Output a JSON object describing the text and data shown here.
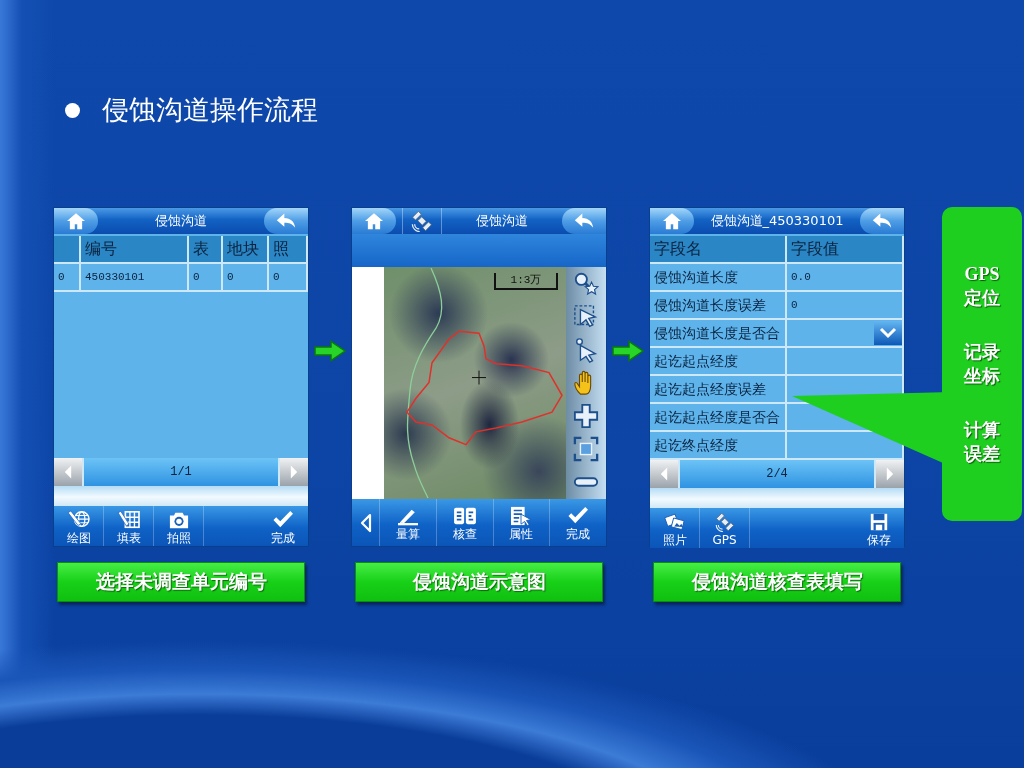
{
  "slide": {
    "title": "侵蚀沟道操作流程"
  },
  "screens": [
    {
      "kind": "table",
      "title": "侵蚀沟道",
      "columns": [
        "编号",
        "表",
        "地块",
        "照"
      ],
      "rows": [
        {
          "index": "0",
          "cells": [
            "450330101",
            "0",
            "0",
            "0"
          ]
        }
      ],
      "page": "1/1",
      "toolbar": [
        {
          "kind": "draw",
          "label": "绘图"
        },
        {
          "kind": "form",
          "label": "填表"
        },
        {
          "kind": "photo",
          "label": "拍照"
        },
        {
          "kind": "done",
          "label": "完成"
        }
      ],
      "caption": "选择未调查单元编号"
    },
    {
      "kind": "map",
      "title": "侵蚀沟道",
      "scale": "1:3万",
      "toolbar": [
        {
          "kind": "measure",
          "label": "量算"
        },
        {
          "kind": "check",
          "label": "核查"
        },
        {
          "kind": "attribute",
          "label": "属性"
        },
        {
          "kind": "done",
          "label": "完成"
        }
      ],
      "caption": "侵蚀沟道示意图"
    },
    {
      "kind": "form",
      "title": "侵蚀沟道_450330101",
      "columns": [
        "字段名",
        "字段值"
      ],
      "rows": [
        {
          "kind": "text",
          "name": "侵蚀沟道长度",
          "value": "0.0"
        },
        {
          "kind": "text",
          "name": "侵蚀沟道长度误差",
          "value": "0"
        },
        {
          "kind": "dropdown",
          "name": "侵蚀沟道长度是否合"
        },
        {
          "kind": "text",
          "name": "起讫起点经度"
        },
        {
          "kind": "text",
          "name": "起讫起点经度误差"
        },
        {
          "kind": "text",
          "name": "起讫起点经度是否合"
        },
        {
          "kind": "text",
          "name": "起讫终点经度"
        }
      ],
      "page": "2/4",
      "toolbar": [
        {
          "kind": "photos",
          "label": "照片"
        },
        {
          "kind": "gps",
          "label": "GPS"
        },
        {
          "kind": "save",
          "label": "保存"
        }
      ],
      "caption": "侵蚀沟道核查表填写"
    }
  ],
  "callout": {
    "groups": [
      {
        "lines": [
          "GPS",
          "定位"
        ]
      },
      {
        "lines": [
          "记录",
          "坐标"
        ]
      },
      {
        "lines": [
          "计算",
          "误差"
        ]
      }
    ]
  }
}
